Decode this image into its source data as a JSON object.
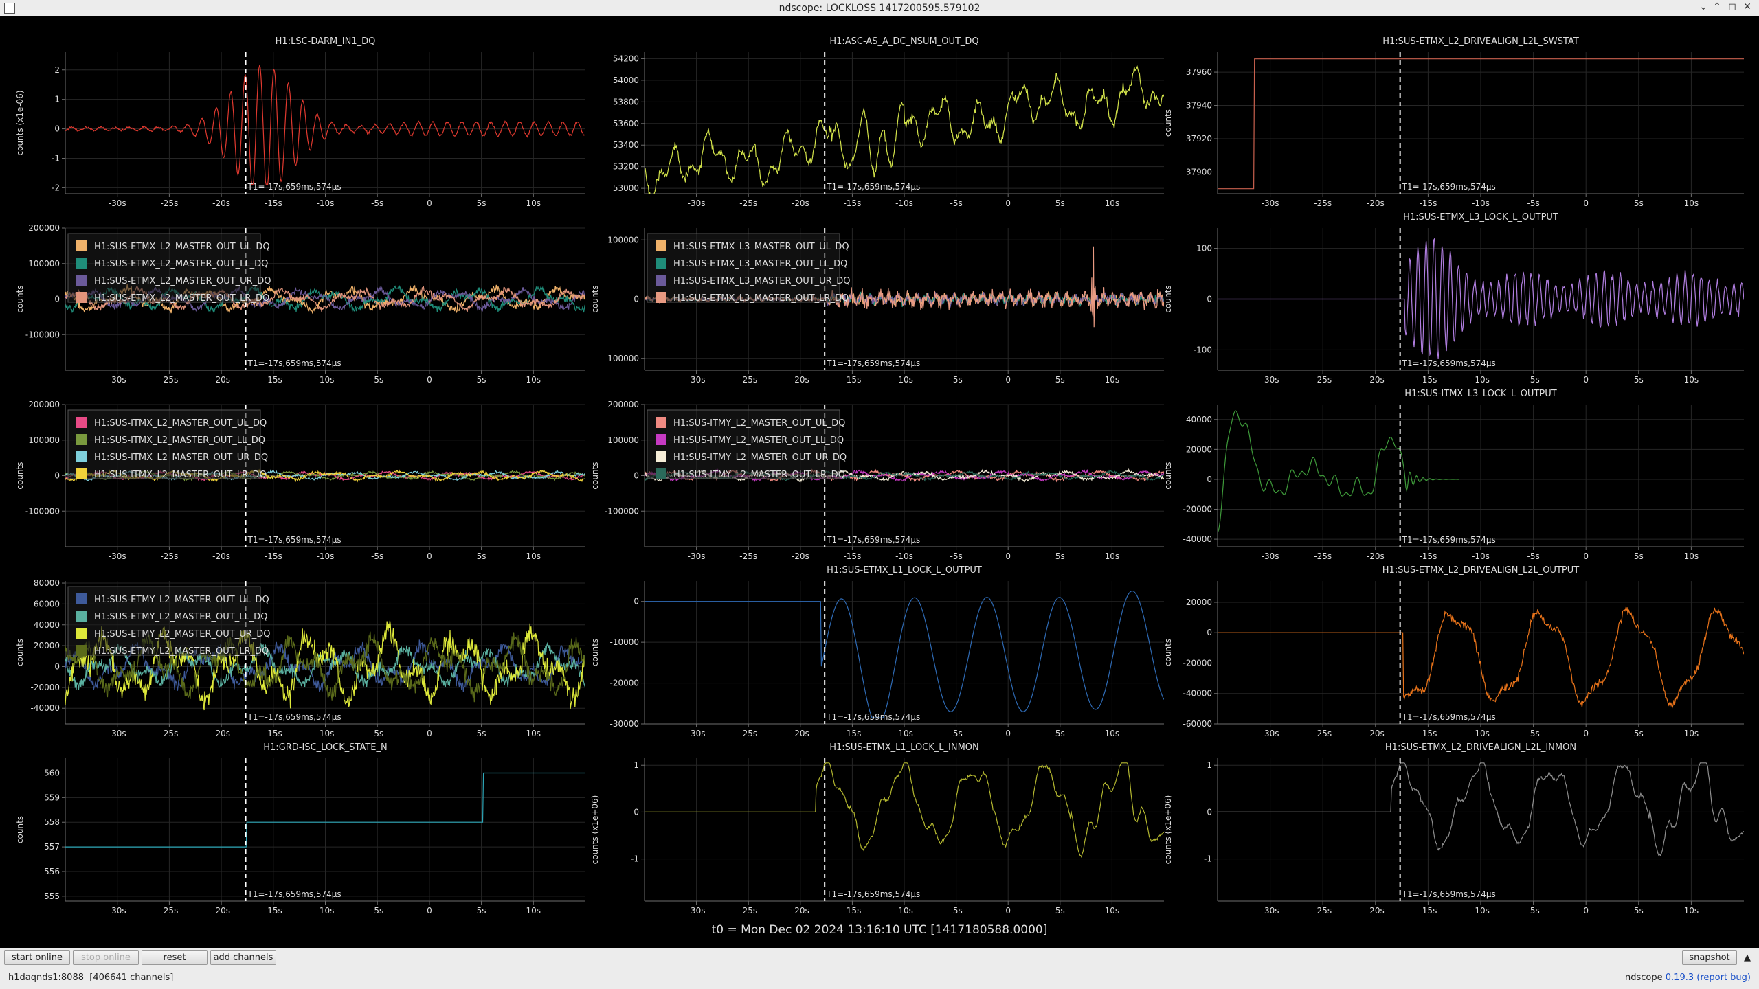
{
  "window": {
    "title": "ndscope: LOCKLOSS 1417200595.579102"
  },
  "cursor_label": "T1=-17s,659ms,574µs",
  "t0_label": "t0 = Mon Dec 02 2024 13:16:10 UTC [1417180588.0000]",
  "toolbar": {
    "start_online": "start online",
    "stop_online": "stop online",
    "reset": "reset",
    "add_channels": "add channels",
    "snapshot": "snapshot"
  },
  "status": {
    "server": "h1daqnds1:8088",
    "channels": "[406641 channels]",
    "app": "ndscope",
    "version": "0.19.3",
    "report_bug": "(report bug)"
  },
  "colors": {
    "background": "#000000",
    "grid": "#262626",
    "axis": "#6e6e6e",
    "text": "#dddddd",
    "cursor": "#ffffff"
  },
  "chart_data": [
    {
      "id": "p1",
      "type": "line",
      "title": "H1:LSC-DARM_IN1_DQ",
      "ylabel": "counts (x1e-06)",
      "ylim": [
        -2.2,
        2.6
      ],
      "yticks": [
        -2,
        -1,
        0,
        1,
        2
      ],
      "xlim": [
        -35,
        15
      ],
      "xticks": [
        -30,
        -25,
        -20,
        -15,
        -10,
        -5,
        0,
        5,
        10
      ],
      "cursor": -17.66,
      "legend": [],
      "series": [
        {
          "color": "#e0392f",
          "kind": "darm"
        }
      ]
    },
    {
      "id": "p2",
      "type": "line",
      "title": "H1:ASC-AS_A_DC_NSUM_OUT_DQ",
      "ylabel": "",
      "ylim": [
        52950,
        54260
      ],
      "yticks": [
        53000,
        53200,
        53400,
        53600,
        53800,
        54000,
        54200
      ],
      "xlim": [
        -35,
        15
      ],
      "xticks": [
        -30,
        -25,
        -20,
        -15,
        -10,
        -5,
        0,
        5,
        10
      ],
      "cursor": -17.66,
      "legend": [],
      "series": [
        {
          "color": "#d2e24a",
          "kind": "asc"
        }
      ]
    },
    {
      "id": "p3",
      "type": "line",
      "title": "H1:SUS-ETMX_L2_DRIVEALIGN_L2L_SWSTAT",
      "ylabel": "counts",
      "ylim": [
        37887,
        37972
      ],
      "yticks": [
        37900,
        37920,
        37940,
        37960
      ],
      "xlim": [
        -35,
        15
      ],
      "xticks": [
        -30,
        -25,
        -20,
        -15,
        -10,
        -5,
        0,
        5,
        10
      ],
      "cursor": -17.66,
      "legend": [],
      "series": [
        {
          "color": "#c8604e",
          "kind": "swstat"
        }
      ]
    },
    {
      "id": "p4",
      "type": "line",
      "title": "",
      "ylabel": "counts",
      "ylim": [
        -200000,
        200000
      ],
      "yticks": [
        -100000,
        0,
        100000,
        200000
      ],
      "xlim": [
        -35,
        15
      ],
      "xticks": [
        -30,
        -25,
        -20,
        -15,
        -10,
        -5,
        0,
        5,
        10
      ],
      "cursor": -17.66,
      "legend": [
        "H1:SUS-ETMX_L2_MASTER_OUT_UL_DQ",
        "H1:SUS-ETMX_L2_MASTER_OUT_LL_DQ",
        "H1:SUS-ETMX_L2_MASTER_OUT_UR_DQ",
        "H1:SUS-ETMX_L2_MASTER_OUT_LR_DQ"
      ],
      "series": [
        {
          "color": "#f0b26a",
          "kind": "noise",
          "amp": 35000
        },
        {
          "color": "#1f8d7a",
          "kind": "noise",
          "amp": 33000
        },
        {
          "color": "#6b5a9a",
          "kind": "noise",
          "amp": 30000
        },
        {
          "color": "#e2957c",
          "kind": "noise",
          "amp": 30000
        }
      ]
    },
    {
      "id": "p5",
      "type": "line",
      "title": "",
      "ylabel": "counts",
      "ylim": [
        -120000,
        120000
      ],
      "yticks": [
        -100000,
        0,
        100000
      ],
      "xlim": [
        -35,
        15
      ],
      "xticks": [
        -30,
        -25,
        -20,
        -15,
        -10,
        -5,
        0,
        5,
        10
      ],
      "cursor": -17.66,
      "legend": [
        "H1:SUS-ETMX_L3_MASTER_OUT_UL_DQ",
        "H1:SUS-ETMX_L3_MASTER_OUT_LL_DQ",
        "H1:SUS-ETMX_L3_MASTER_OUT_UR_DQ",
        "H1:SUS-ETMX_L3_MASTER_OUT_LR_DQ"
      ],
      "series": [
        {
          "color": "#f0b26a",
          "kind": "l3",
          "amp": 9000
        },
        {
          "color": "#1f8d7a",
          "kind": "l3",
          "amp": 9000
        },
        {
          "color": "#6b5a9a",
          "kind": "l3",
          "amp": 9000
        },
        {
          "color": "#e89a82",
          "kind": "l3",
          "amp": 14000
        }
      ]
    },
    {
      "id": "p6",
      "type": "line",
      "title": "H1:SUS-ETMX_L3_LOCK_L_OUTPUT",
      "ylabel": "counts",
      "ylim": [
        -140,
        140
      ],
      "yticks": [
        -100,
        0,
        100
      ],
      "xlim": [
        -35,
        15
      ],
      "xticks": [
        -30,
        -25,
        -20,
        -15,
        -10,
        -5,
        0,
        5,
        10
      ],
      "cursor": -17.66,
      "legend": [],
      "series": [
        {
          "color": "#b07ee0",
          "kind": "l3lock"
        }
      ]
    },
    {
      "id": "p7",
      "type": "line",
      "title": "",
      "ylabel": "counts",
      "ylim": [
        -200000,
        200000
      ],
      "yticks": [
        -100000,
        0,
        100000,
        200000
      ],
      "xlim": [
        -35,
        15
      ],
      "xticks": [
        -30,
        -25,
        -20,
        -15,
        -10,
        -5,
        0,
        5,
        10
      ],
      "cursor": -17.66,
      "legend": [
        "H1:SUS-ITMX_L2_MASTER_OUT_UL_DQ",
        "H1:SUS-ITMX_L2_MASTER_OUT_LL_DQ",
        "H1:SUS-ITMX_L2_MASTER_OUT_UR_DQ",
        "H1:SUS-ITMX_L2_MASTER_OUT_LR_DQ"
      ],
      "series": [
        {
          "color": "#e84a86",
          "kind": "noise",
          "amp": 12000
        },
        {
          "color": "#7a9a3e",
          "kind": "noise",
          "amp": 12000
        },
        {
          "color": "#7fd0dc",
          "kind": "noise",
          "amp": 12000
        },
        {
          "color": "#f0d23a",
          "kind": "noise",
          "amp": 14000
        }
      ]
    },
    {
      "id": "p8",
      "type": "line",
      "title": "",
      "ylabel": "counts",
      "ylim": [
        -200000,
        200000
      ],
      "yticks": [
        -100000,
        0,
        100000,
        200000
      ],
      "xlim": [
        -35,
        15
      ],
      "xticks": [
        -30,
        -25,
        -20,
        -15,
        -10,
        -5,
        0,
        5,
        10
      ],
      "cursor": -17.66,
      "legend": [
        "H1:SUS-ITMY_L2_MASTER_OUT_UL_DQ",
        "H1:SUS-ITMY_L2_MASTER_OUT_LL_DQ",
        "H1:SUS-ITMY_L2_MASTER_OUT_UR_DQ",
        "H1:SUS-ITMY_L2_MASTER_OUT_LR_DQ"
      ],
      "series": [
        {
          "color": "#f08a82",
          "kind": "noise",
          "amp": 14000
        },
        {
          "color": "#c63ac2",
          "kind": "noise",
          "amp": 14000
        },
        {
          "color": "#f6eed8",
          "kind": "noise",
          "amp": 14000
        },
        {
          "color": "#2a6a5a",
          "kind": "noise",
          "amp": 12000
        }
      ]
    },
    {
      "id": "p9",
      "type": "line",
      "title": "H1:SUS-ITMX_L3_LOCK_L_OUTPUT",
      "ylabel": "counts",
      "ylim": [
        -45000,
        50000
      ],
      "yticks": [
        -40000,
        -20000,
        0,
        20000,
        40000
      ],
      "xlim": [
        -35,
        15
      ],
      "xticks": [
        -30,
        -25,
        -20,
        -15,
        -10,
        -5,
        0,
        5,
        10
      ],
      "cursor": -17.66,
      "legend": [],
      "series": [
        {
          "color": "#3e9a3a",
          "kind": "itmxl3"
        }
      ]
    },
    {
      "id": "p10",
      "type": "line",
      "title": "",
      "ylabel": "counts",
      "ylim": [
        -55000,
        82000
      ],
      "yticks": [
        -40000,
        -20000,
        0,
        20000,
        40000,
        60000,
        80000
      ],
      "xlim": [
        -35,
        15
      ],
      "xticks": [
        -30,
        -25,
        -20,
        -15,
        -10,
        -5,
        0,
        5,
        10
      ],
      "cursor": -17.66,
      "legend": [
        "H1:SUS-ETMY_L2_MASTER_OUT_UL_DQ",
        "H1:SUS-ETMY_L2_MASTER_OUT_LL_DQ",
        "H1:SUS-ETMY_L2_MASTER_OUT_UR_DQ",
        "H1:SUS-ETMY_L2_MASTER_OUT_LR_DQ"
      ],
      "series": [
        {
          "color": "#3e5a9a",
          "kind": "noise",
          "amp": 22000
        },
        {
          "color": "#5ab0a0",
          "kind": "noise",
          "amp": 20000
        },
        {
          "color": "#dde83a",
          "kind": "noise",
          "amp": 38000
        },
        {
          "color": "#5a6a1a",
          "kind": "noise",
          "amp": 30000
        }
      ]
    },
    {
      "id": "p11",
      "type": "line",
      "title": "H1:SUS-ETMX_L1_LOCK_L_OUTPUT",
      "ylabel": "counts",
      "ylim": [
        -30000,
        5000
      ],
      "yticks": [
        -30000,
        -20000,
        -10000,
        0
      ],
      "xlim": [
        -35,
        15
      ],
      "xticks": [
        -30,
        -25,
        -20,
        -15,
        -10,
        -5,
        0,
        5,
        10
      ],
      "cursor": -17.66,
      "legend": [],
      "series": [
        {
          "color": "#2e6ab4",
          "kind": "etmxl1"
        }
      ]
    },
    {
      "id": "p12",
      "type": "line",
      "title": "H1:SUS-ETMX_L2_DRIVEALIGN_L2L_OUTPUT",
      "ylabel": "counts",
      "ylim": [
        -60000,
        34000
      ],
      "yticks": [
        -60000,
        -40000,
        -20000,
        0,
        20000
      ],
      "xlim": [
        -35,
        15
      ],
      "xticks": [
        -30,
        -25,
        -20,
        -15,
        -10,
        -5,
        0,
        5,
        10
      ],
      "cursor": -17.66,
      "legend": [],
      "series": [
        {
          "color": "#e8731a",
          "kind": "etmxl2da"
        }
      ]
    },
    {
      "id": "p13",
      "type": "line",
      "title": "H1:GRD-ISC_LOCK_STATE_N",
      "ylabel": "counts",
      "ylim": [
        554.8,
        560.6
      ],
      "yticks": [
        555,
        556,
        557,
        558,
        559,
        560
      ],
      "xlim": [
        -35,
        15
      ],
      "xticks": [
        -30,
        -25,
        -20,
        -15,
        -10,
        -5,
        0,
        5,
        10
      ],
      "cursor": -17.66,
      "legend": [],
      "series": [
        {
          "color": "#2ea7b8",
          "kind": "grd"
        }
      ]
    },
    {
      "id": "p14",
      "type": "line",
      "title": "H1:SUS-ETMX_L1_LOCK_L_INMON",
      "ylabel": "counts (x1e+06)",
      "ylim": [
        -1.9,
        1.15
      ],
      "yticks": [
        -1,
        0,
        1
      ],
      "xlim": [
        -35,
        15
      ],
      "xticks": [
        -30,
        -25,
        -20,
        -15,
        -10,
        -5,
        0,
        5,
        10
      ],
      "cursor": -17.66,
      "legend": [],
      "series": [
        {
          "color": "#b4b830",
          "kind": "inmon"
        }
      ]
    },
    {
      "id": "p15",
      "type": "line",
      "title": "H1:SUS-ETMX_L2_DRIVEALIGN_L2L_INMON",
      "ylabel": "counts (x1e+06)",
      "ylim": [
        -1.9,
        1.15
      ],
      "yticks": [
        -1,
        0,
        1
      ],
      "xlim": [
        -35,
        15
      ],
      "xticks": [
        -30,
        -25,
        -20,
        -15,
        -10,
        -5,
        0,
        5,
        10
      ],
      "cursor": -17.66,
      "legend": [],
      "series": [
        {
          "color": "#8e8e8e",
          "kind": "inmon2"
        }
      ]
    }
  ]
}
